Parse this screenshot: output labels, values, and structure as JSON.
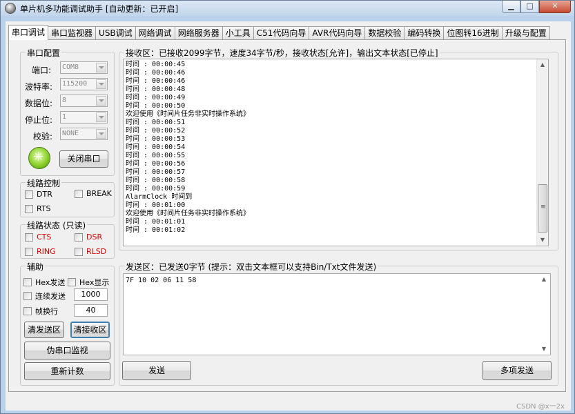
{
  "window": {
    "title": "单片机多功能调试助手 [自动更新：已开启]",
    "min_icon": "minimize-icon",
    "max_icon": "maximize-icon",
    "close_icon": "close-icon"
  },
  "tabs": [
    {
      "label": "串口调试",
      "active": true
    },
    {
      "label": "串口监视器"
    },
    {
      "label": "USB调试"
    },
    {
      "label": "网络调试"
    },
    {
      "label": "网络服务器"
    },
    {
      "label": "小工具"
    },
    {
      "label": "C51代码向导"
    },
    {
      "label": "AVR代码向导"
    },
    {
      "label": "数据校验"
    },
    {
      "label": "编码转换"
    },
    {
      "label": "位图转16进制"
    },
    {
      "label": "升级与配置"
    }
  ],
  "serial_config": {
    "title": "串口配置",
    "port_label": "端口:",
    "port_value": "COM8",
    "baud_label": "波特率:",
    "baud_value": "115200",
    "databits_label": "数据位:",
    "databits_value": "8",
    "stopbits_label": "停止位:",
    "stopbits_value": "1",
    "parity_label": "校验:",
    "parity_value": "NONE",
    "status_led_icon": "port-open-led-icon",
    "close_port_label": "关闭串口"
  },
  "line_control": {
    "title": "线路控制",
    "dtr": "DTR",
    "break": "BREAK",
    "rts": "RTS"
  },
  "line_status": {
    "title": "线路状态 (只读)",
    "cts": "CTS",
    "dsr": "DSR",
    "ring": "RING",
    "rlsd": "RLSD",
    "status_color": "#e00000"
  },
  "aux": {
    "title": "辅助",
    "hex_send": "Hex发送",
    "hex_display": "Hex显示",
    "continuous_send": "连续发送",
    "continuous_interval": "1000",
    "frame_newline": "帧换行",
    "frame_value": "40",
    "clear_send": "清发送区",
    "clear_receive": "清接收区",
    "fake_monitor": "伪串口监视",
    "recount": "重新计数"
  },
  "receive": {
    "title": "接收区：已接收2099字节，速度34字节/秒，接收状态[允许]，输出文本状态[已停止]",
    "lines": [
      "时间 : 00:00:45",
      "时间 : 00:00:46",
      "时间 : 00:00:46",
      "时间 : 00:00:48",
      "时间 : 00:00:49",
      "时间 : 00:00:50",
      "欢迎使用《时间片任务非实时操作系统》",
      "时间 : 00:00:51",
      "时间 : 00:00:52",
      "时间 : 00:00:53",
      "时间 : 00:00:54",
      "时间 : 00:00:55",
      "时间 : 00:00:56",
      "时间 : 00:00:57",
      "时间 : 00:00:58",
      "时间 : 00:00:59",
      "AlarmClock 时间到",
      "时间 : 00:01:00",
      "欢迎使用《时间片任务非实时操作系统》",
      "时间 : 00:01:01",
      "时间 : 00:01:02"
    ]
  },
  "send": {
    "title": "发送区：已发送0字节 (提示：双击文本框可以支持Bin/Txt文件发送)",
    "content": "7F 10 02 06 11 58",
    "send_button": "发送",
    "multi_send_button": "多项发送"
  },
  "watermark": "CSDN @x一2x"
}
